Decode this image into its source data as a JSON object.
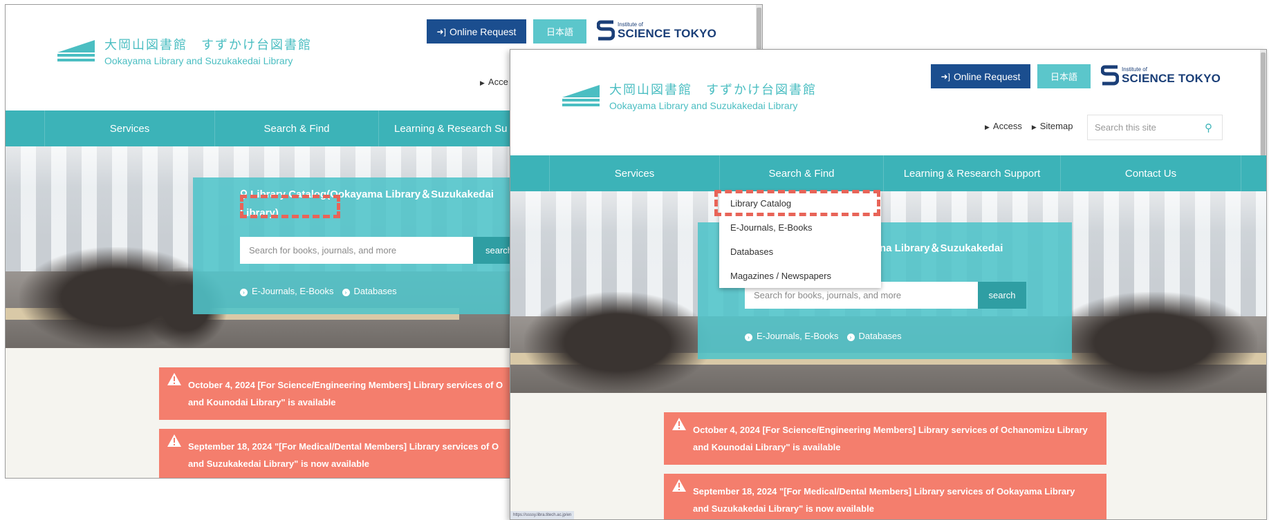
{
  "site": {
    "logo_jp": "大岡山図書館　すずかけ台図書館",
    "logo_en": "Ookayama Library and Suzukakedai Library",
    "online_request": "Online Request",
    "japanese": "日本語",
    "brand_small": "Institute of",
    "brand_big": "SCIENCE TOKYO",
    "access": "Access",
    "sitemap": "Sitemap",
    "site_search_placeholder": "Search this site"
  },
  "nav": {
    "services": "Services",
    "search_find": "Search & Find",
    "learning": "Learning & Research Support",
    "contact": "Contact Us"
  },
  "screen_a": {
    "nav_learning": "Learning & Research Su",
    "access": "Acce",
    "panel_title_line1": "Library Catalog(Ookayama Library＆Suzukakedai",
    "panel_title_line2": "Library)",
    "search_placeholder": "Search for books, journals, and more",
    "search_button": "search",
    "link_ejournals": "E-Journals, E-Books",
    "link_databases": "Databases",
    "notice1_line1": "October 4, 2024 [For Science/Engineering Members] Library services of O",
    "notice1_line2": "and Kounodai Library\" is available",
    "notice2_line1": "September 18, 2024 \"[For Medical/Dental Members] Library services of O",
    "notice2_line2": "and Suzukakedai Library\" is now available"
  },
  "screen_b": {
    "dropdown": [
      "Library Catalog",
      "E-Journals, E-Books",
      "Databases",
      "Magazines / Newspapers"
    ],
    "panel_title_visible": "na Library＆Suzukakedai",
    "search_placeholder": "Search for books, journals, and more",
    "search_button": "search",
    "link_ejournals": "E-Journals, E-Books",
    "link_databases": "Databases",
    "notice1_line1": "October 4, 2024 [For Science/Engineering Members] Library services of Ochanomizu Library",
    "notice1_line2": "and Kounodai Library\" is available",
    "notice2_line1": "September 18, 2024 \"[For Medical/Dental Members] Library services of Ookayama Library",
    "notice2_line2": "and Suzukakedai Library\" is now available",
    "status_url": "https://ssssy.libra.titech.ac.jp/en"
  },
  "colors": {
    "teal": "#3cb3b8",
    "navy": "#1b4e8f",
    "notice": "#f47e6d",
    "highlight": "#e86458"
  }
}
